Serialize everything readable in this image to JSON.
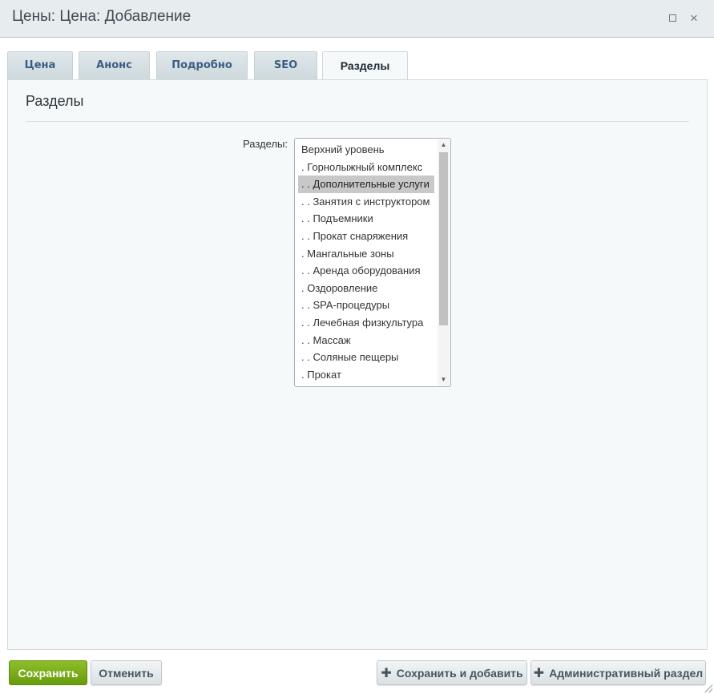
{
  "window": {
    "title": "Цены: Цена: Добавление",
    "maximize_icon": "maximize-icon",
    "close_symbol": "×"
  },
  "tabs": [
    {
      "label": "Цена"
    },
    {
      "label": "Анонс"
    },
    {
      "label": "Подробно"
    },
    {
      "label": "SEO"
    },
    {
      "label": "Разделы",
      "active": true
    }
  ],
  "panel": {
    "title": "Разделы",
    "field_label": "Разделы:",
    "sections_list": [
      "Верхний уровень",
      ". Горнолыжный комплекс",
      ". . Дополнительные услуги",
      ". . Занятия с инструктором",
      ". . Подъемники",
      ". . Прокат снаряжения",
      ". Мангальные зоны",
      ". . Аренда оборудования",
      ". Оздоровление",
      ". . SPA-процедуры",
      ". . Лечебная физкультура",
      ". . Массаж",
      ". . Соляные пещеры",
      ". Прокат"
    ],
    "selected": ". . Дополнительные услуги"
  },
  "footer": {
    "save_label": "Сохранить",
    "cancel_label": "Отменить",
    "save_add_label": "Сохранить и добавить",
    "admin_label": "Административный раздел"
  },
  "colors": {
    "accent_green": "#7cb01e",
    "tab_text": "#3b5d82",
    "selected_bg": "#c8c8c8"
  }
}
